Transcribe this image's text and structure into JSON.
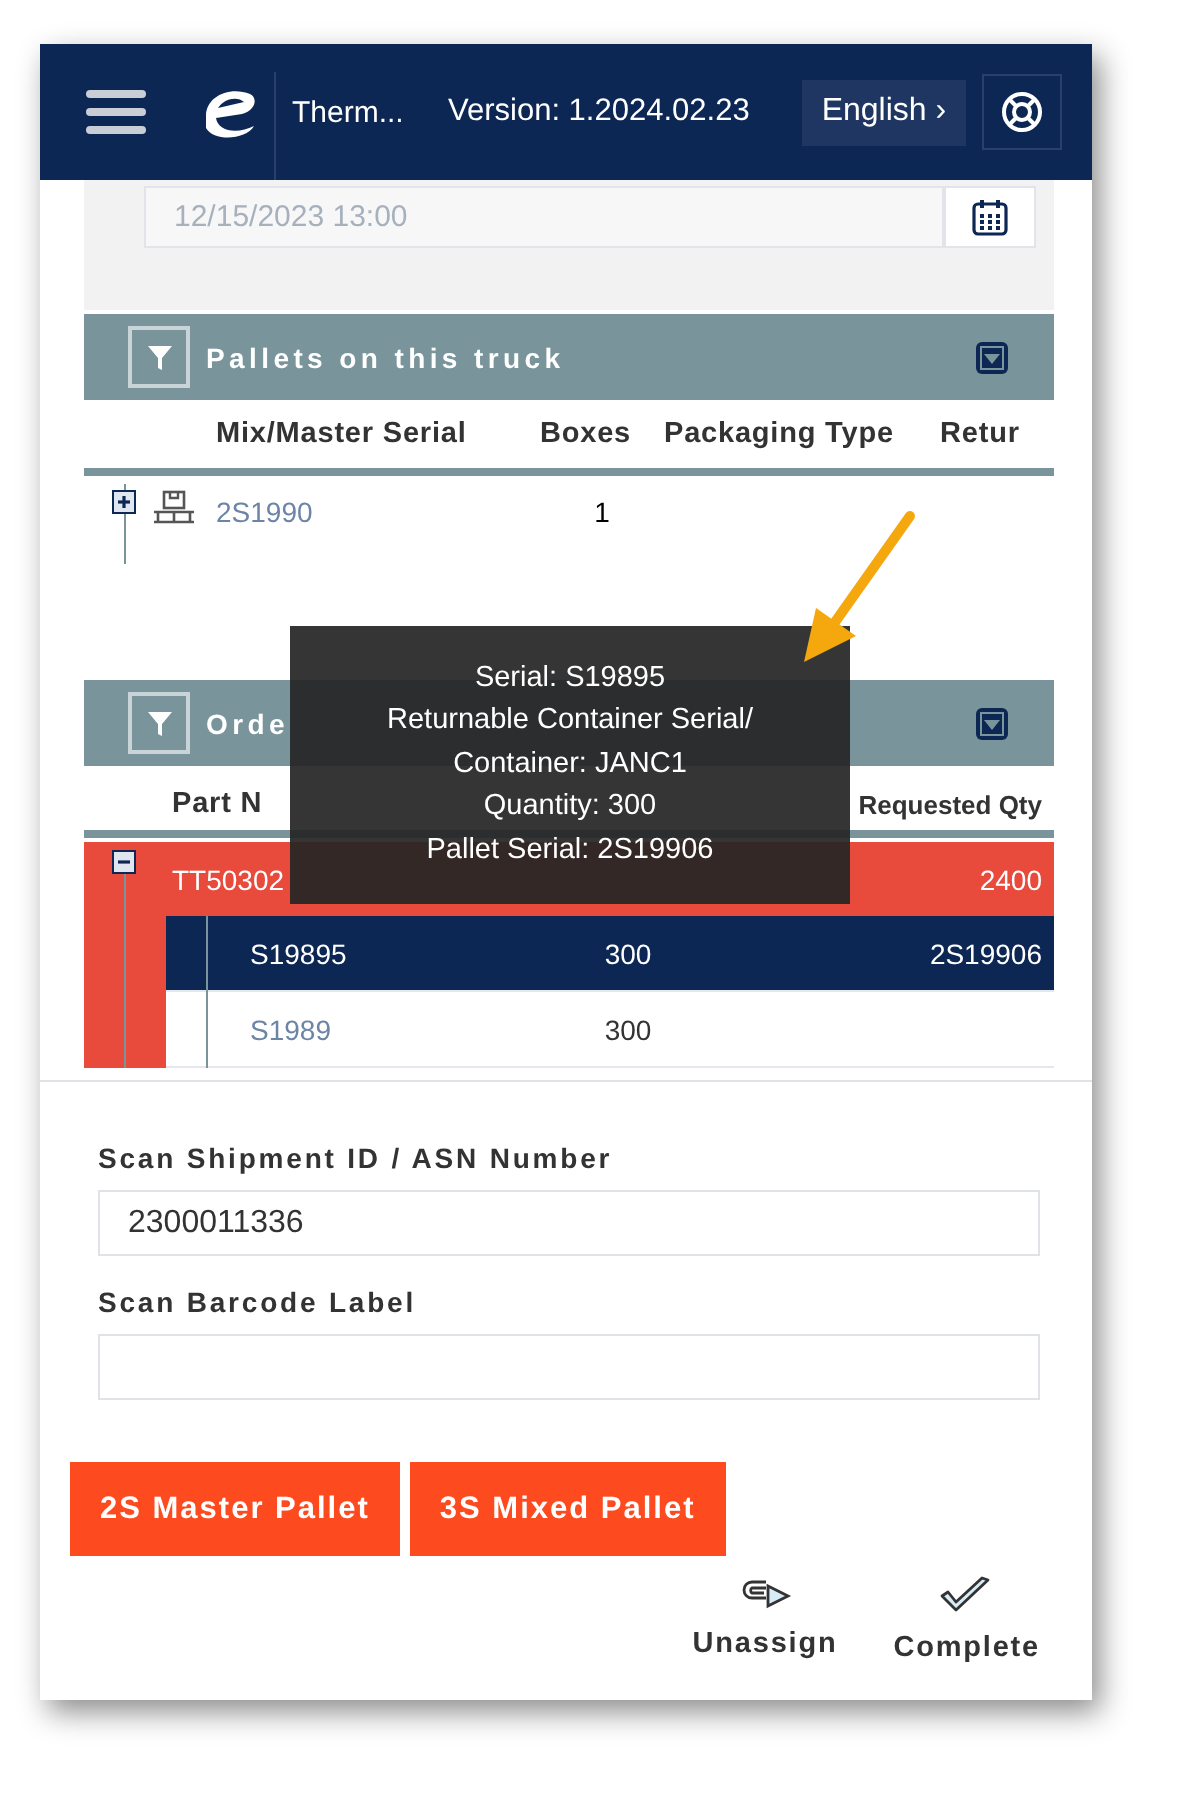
{
  "header": {
    "app_title": "Therm...",
    "version": "Version: 1.2024.02.23",
    "language": "English ›"
  },
  "date_field": {
    "value": "12/15/2023 13:00"
  },
  "pallets": {
    "title": "Pallets on this truck",
    "columns": [
      "Mix/Master Serial",
      "Boxes",
      "Packaging Type",
      "Retur"
    ],
    "rows": [
      {
        "serial": "2S1990",
        "boxes": "1",
        "expanded": false
      }
    ]
  },
  "orders": {
    "title": "Orde",
    "columns": [
      {
        "kind": "part",
        "label": "Part N"
      },
      {
        "kind": "requested",
        "label": "Requested Qty"
      }
    ],
    "rows": [
      {
        "part": "TT50302",
        "requested": "2400",
        "expanded": true,
        "children": [
          {
            "part": "S19895",
            "shipped": "300",
            "requested": "2S19906",
            "selected": true
          },
          {
            "part": "S1989",
            "shipped": "300",
            "selected": false
          }
        ]
      }
    ]
  },
  "tooltip": [
    "Serial: S19895",
    "Returnable Container Serial/",
    "Container: JANC1",
    "Quantity: 300",
    "Pallet Serial: 2S19906"
  ],
  "form": [
    {
      "label": "Scan Shipment ID / ASN Number",
      "value": "2300011336"
    },
    {
      "label": "Scan Barcode Label"
    }
  ],
  "pallet_buttons": [
    "2S Master Pallet",
    "3S Mixed Pallet"
  ],
  "actions": [
    {
      "kind": "unassign",
      "label": "Unassign"
    },
    {
      "kind": "complete",
      "label": "Complete"
    }
  ]
}
